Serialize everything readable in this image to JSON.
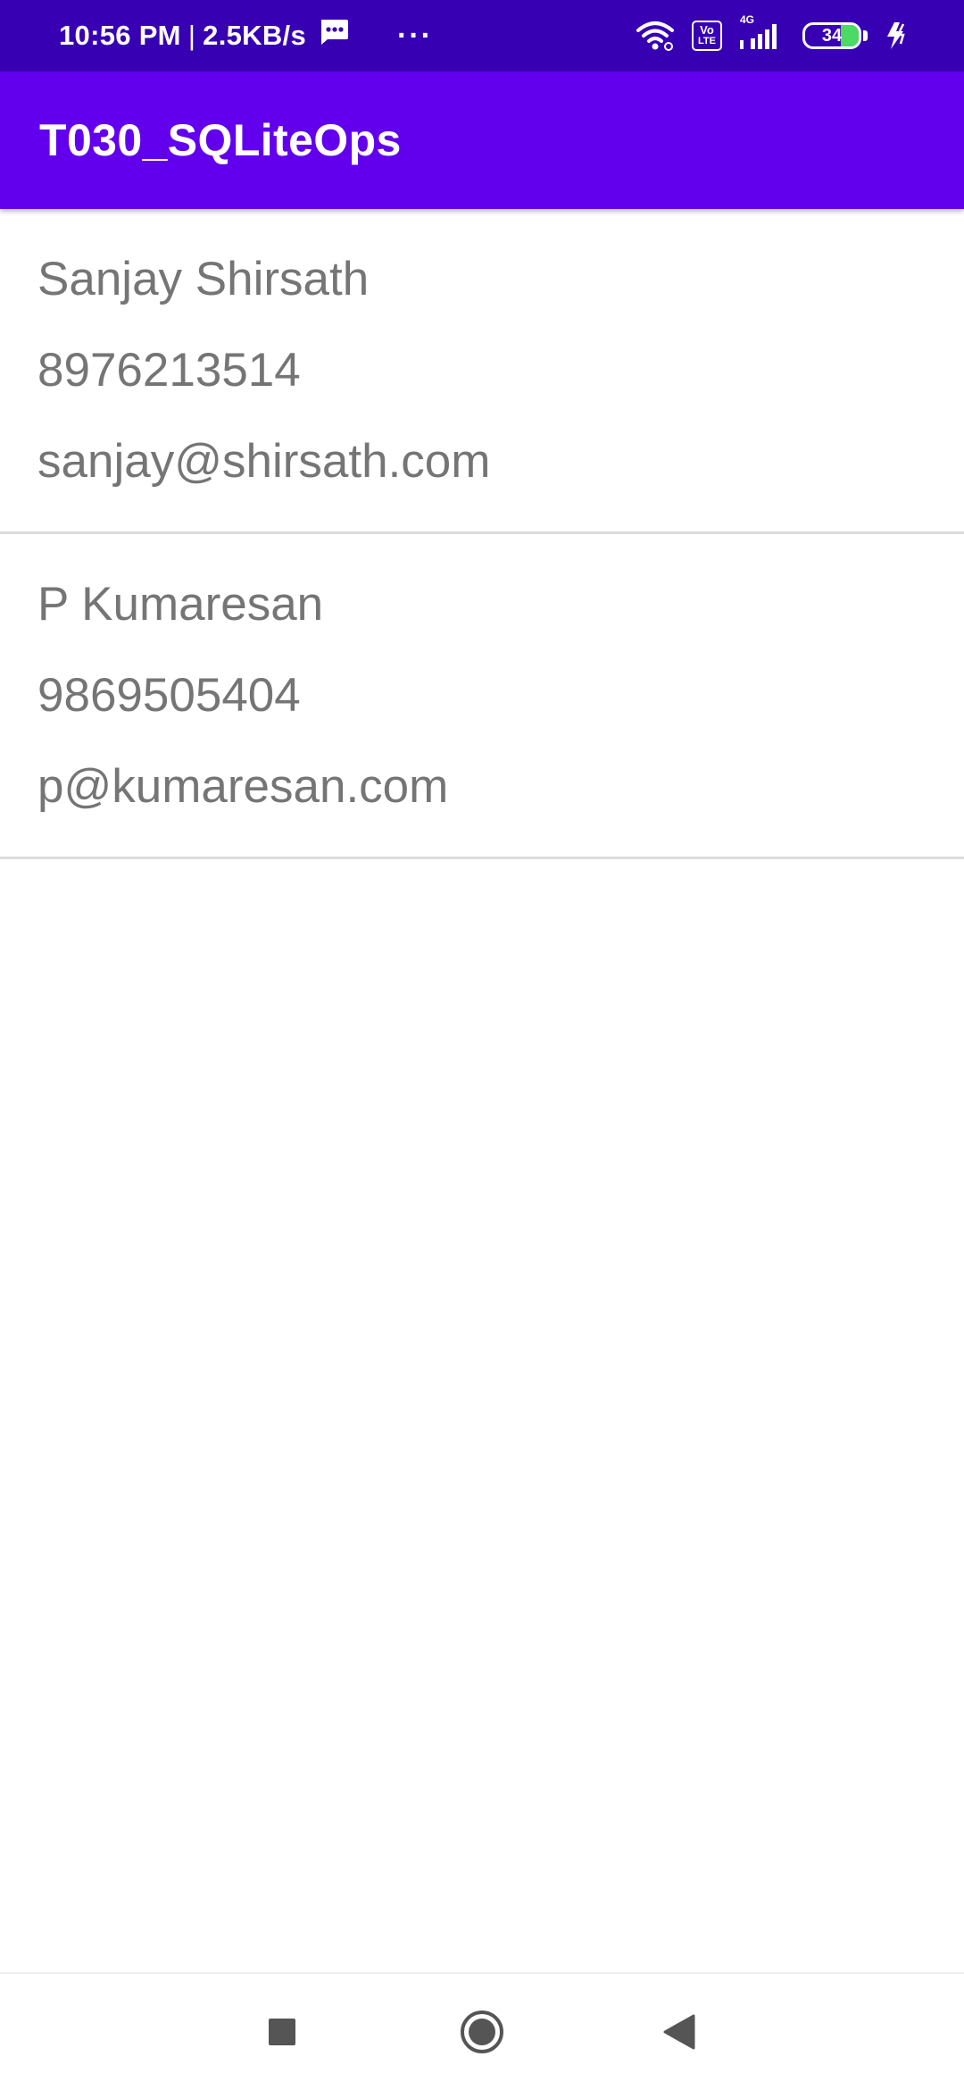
{
  "status_bar": {
    "time": "10:56 PM",
    "separator": "|",
    "net_speed": "2.5KB/s",
    "more": "···",
    "volte_label_1": "Vo",
    "volte_label_2": "LTE",
    "network_type": "4G",
    "battery_level": "34",
    "icons": [
      "message-icon",
      "wifi-icon",
      "volte-icon",
      "signal-icon",
      "battery-icon",
      "charging-icon"
    ]
  },
  "app_bar": {
    "title": "T030_SQLiteOps",
    "color": "#6200ee"
  },
  "contacts": [
    {
      "name": "Sanjay Shirsath",
      "phone": "8976213514",
      "email": "sanjay@shirsath.com"
    },
    {
      "name": "P Kumaresan",
      "phone": "9869505404",
      "email": "p@kumaresan.com"
    }
  ],
  "nav_bar": {
    "icons": [
      "recents-icon",
      "home-icon",
      "back-icon"
    ]
  },
  "colors": {
    "status_bar": "#3700b3",
    "app_bar": "#6200ee",
    "text_secondary": "#757575",
    "divider": "#dcdcdc"
  }
}
